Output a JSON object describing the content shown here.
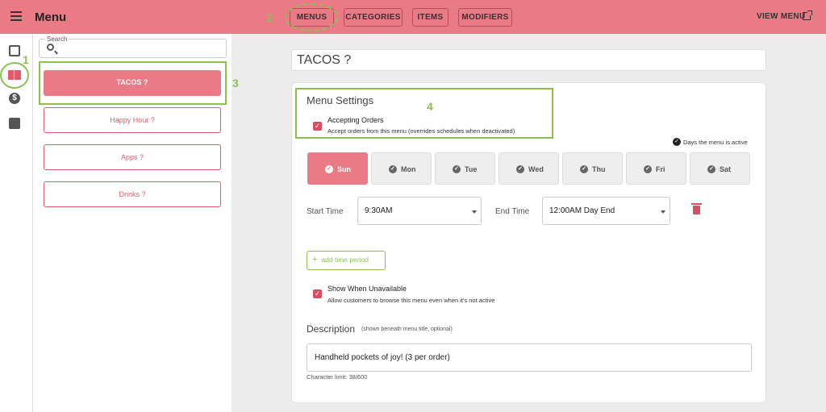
{
  "header": {
    "title": "Menu",
    "nav": [
      "MENUS",
      "CATEGORIES",
      "ITEMS",
      "MODIFIERS"
    ],
    "view_menu": "VIEW MENU"
  },
  "sidebar": {
    "search_label": "Search",
    "menus": [
      "TACOS ?",
      "Happy Hour ?",
      "Apps ?",
      "Drinks ?"
    ],
    "active_index": 0
  },
  "main": {
    "title": "TACOS ?",
    "settings_heading": "Menu Settings",
    "accepting": {
      "title": "Accepting Orders",
      "subtitle": "Accept orders from this menu (overrides schedules when deactivated)",
      "checked": true
    },
    "days_legend": "Days the menu is active",
    "days": [
      {
        "label": "Sun",
        "active": true
      },
      {
        "label": "Mon",
        "active": false
      },
      {
        "label": "Tue",
        "active": false
      },
      {
        "label": "Wed",
        "active": false
      },
      {
        "label": "Thu",
        "active": false
      },
      {
        "label": "Fri",
        "active": false
      },
      {
        "label": "Sat",
        "active": false
      }
    ],
    "start_time_label": "Start Time",
    "start_time": "9:30AM",
    "end_time_label": "End Time",
    "end_time": "12:00AM Day End",
    "add_period": "add time period",
    "show_unavailable": {
      "title": "Show When Unavailable",
      "subtitle": "Allow customers to browse this menu even when it's not active",
      "checked": true
    },
    "description_heading": "Description",
    "description_hint": "(shown beneath menu title, optional)",
    "description_value": "Handheld pockets of joy! (3 per order)",
    "char_limit": "Character limit: 38/600"
  },
  "annotations": [
    "1",
    "2",
    "3",
    "4"
  ],
  "colors": {
    "brand": "#ea7b86",
    "accent": "#d94e61",
    "annotation": "#8cc152"
  }
}
